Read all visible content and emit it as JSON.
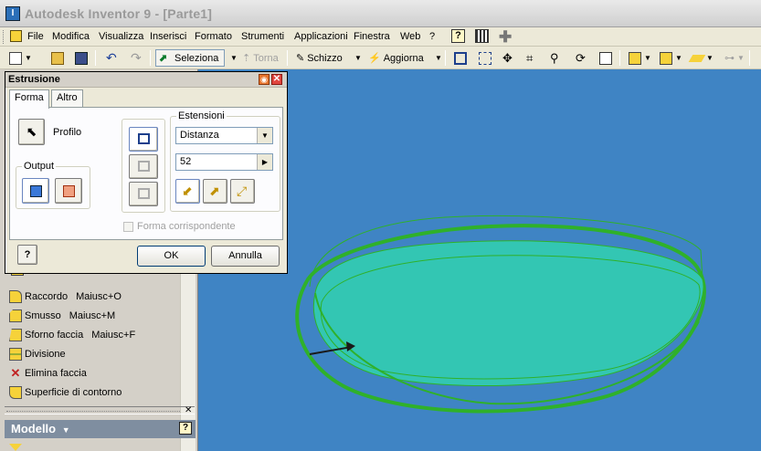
{
  "window": {
    "title": "Autodesk Inventor 9  - [Parte1]"
  },
  "menu": {
    "items": [
      {
        "label": "File"
      },
      {
        "label": "Modifica"
      },
      {
        "label": "Visualizza"
      },
      {
        "label": "Inserisci"
      },
      {
        "label": "Formato"
      },
      {
        "label": "Strumenti"
      },
      {
        "label": "Applicazioni"
      },
      {
        "label": "Finestra"
      },
      {
        "label": "Web"
      },
      {
        "label": "?"
      }
    ]
  },
  "toolbar": {
    "seleziona_label": "Seleziona",
    "torna_label": "Torna",
    "schizzo_label": "Schizzo",
    "aggiorna_label": "Aggiorna"
  },
  "dialog": {
    "title": "Estrusione",
    "tabs": [
      {
        "label": "Forma"
      },
      {
        "label": "Altro"
      }
    ],
    "profile_label": "Profilo",
    "output_label": "Output",
    "extents_label": "Estensioni",
    "extent_type": "Distanza",
    "distance_value": "52",
    "match_shape_label": "Forma corrispondente",
    "ok_label": "OK",
    "cancel_label": "Annulla"
  },
  "panel": {
    "items": [
      {
        "label": "Raccordo",
        "shortcut": "Maiusc+O"
      },
      {
        "label": "Smusso",
        "shortcut": "Maiusc+M"
      },
      {
        "label": "Sforno faccia",
        "shortcut": "Maiusc+F"
      },
      {
        "label": "Divisione",
        "shortcut": ""
      },
      {
        "label": "Elimina faccia",
        "shortcut": ""
      },
      {
        "label": "Superficie di contorno",
        "shortcut": ""
      }
    ],
    "browser_title": "Modello"
  },
  "colors": {
    "viewport_bg": "#3f84c4",
    "profile_fill": "#33c6b3",
    "profile_outline": "#2fb12a"
  }
}
